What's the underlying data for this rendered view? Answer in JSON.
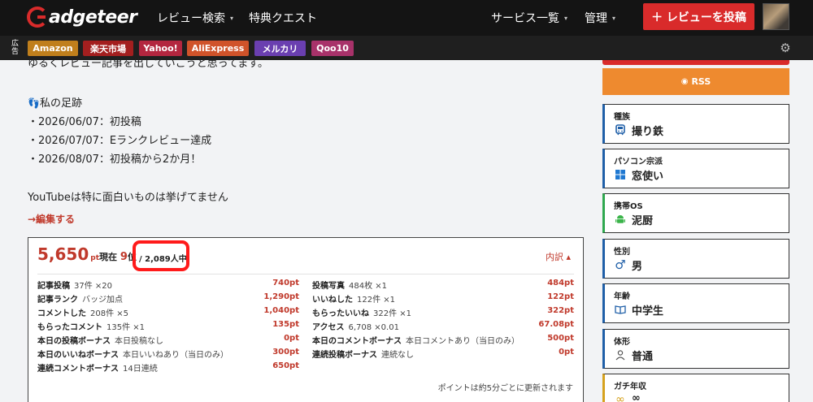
{
  "header": {
    "logo_text": "adgeteer",
    "nav_review_search": "レビュー検索",
    "nav_perk_quest": "特典クエスト",
    "nav_services": "サービス一覧",
    "nav_admin": "管理",
    "caret": "▾",
    "post_button": "＋ レビューを投稿"
  },
  "adbar": {
    "label": "広告",
    "links": [
      {
        "label": "Amazon",
        "color": "#c07f1c"
      },
      {
        "label": "楽天市場",
        "color": "#a31f1f"
      },
      {
        "label": "Yahoo!",
        "color": "#b3263f"
      },
      {
        "label": "AliExpress",
        "color": "#d0532a"
      },
      {
        "label": "メルカリ",
        "color": "#6a3fb0"
      },
      {
        "label": "Qoo10",
        "color": "#a8326a"
      }
    ]
  },
  "profile_text": {
    "intro_line": "ゆるくレビュー記事を出していこうと思ってます。",
    "footprints_heading": "私の足跡",
    "history": [
      "・2026/06/07：初投稿",
      "・2026/07/07：Eランクレビュー達成",
      "・2026/08/07：初投稿から2か月！"
    ],
    "youtube_line": "YouTubeは特に面白いものは挙げてません",
    "edit_link": "→編集する"
  },
  "points": {
    "total": "5,650",
    "unit": "pt",
    "rank_prefix": "現在",
    "rank_value": "9",
    "rank_suffix": "位",
    "rank_total": "/ 2,089人中",
    "breakdown_toggle": "内訳 ▴",
    "left_rows": [
      {
        "label": "記事投稿",
        "detail": "37件 ×20",
        "value": "740pt"
      },
      {
        "label": "記事ランク",
        "detail": "バッジ加点",
        "value": "1,290pt"
      },
      {
        "label": "コメントした",
        "detail": "208件 ×5",
        "value": "1,040pt"
      },
      {
        "label": "もらったコメント",
        "detail": "135件 ×1",
        "value": "135pt"
      },
      {
        "label": "本日の投稿ボーナス",
        "detail": "本日投稿なし",
        "value": "0pt"
      },
      {
        "label": "本日のいいねボーナス",
        "detail": "本日いいねあり（当日のみ）",
        "value": "300pt"
      },
      {
        "label": "連続コメントボーナス",
        "detail": "14日連続",
        "value": "650pt"
      }
    ],
    "right_rows": [
      {
        "label": "投稿写真",
        "detail": "484枚 ×1",
        "value": "484pt"
      },
      {
        "label": "いいねした",
        "detail": "122件 ×1",
        "value": "122pt"
      },
      {
        "label": "もらったいいね",
        "detail": "322件 ×1",
        "value": "322pt"
      },
      {
        "label": "アクセス",
        "detail": "6,708 ×0.01",
        "value": "67.08pt"
      },
      {
        "label": "本日のコメントボーナス",
        "detail": "本日コメントあり（当日のみ）",
        "value": "500pt"
      },
      {
        "label": "連続投稿ボーナス",
        "detail": "連続なし",
        "value": "0pt"
      }
    ],
    "update_note": "ポイントは約5分ごとに更新されます"
  },
  "sidebar": {
    "rss_label": "RSS",
    "cards": [
      {
        "title": "種族",
        "value": "撮り鉄",
        "icon": "train-icon",
        "accent": "#1f5fa8"
      },
      {
        "title": "パソコン宗派",
        "value": "窓使い",
        "icon": "windows-icon",
        "accent": "#1f5fa8"
      },
      {
        "title": "携帯OS",
        "value": "泥厨",
        "icon": "android-icon",
        "accent": "#2fa84f"
      },
      {
        "title": "性別",
        "value": "男",
        "icon": "male-icon",
        "accent": "#1f5fa8"
      },
      {
        "title": "年齢",
        "value": "中学生",
        "icon": "book-icon",
        "accent": "#1f5fa8"
      },
      {
        "title": "体形",
        "value": "普通",
        "icon": "person-icon",
        "accent": "#1f5fa8"
      },
      {
        "title": "ガチ年収",
        "value": "∞",
        "icon": "infinity-icon",
        "accent": "#d6a21e"
      }
    ]
  },
  "colors": {
    "brand_red": "#d92b2b",
    "point_red": "#c0392b",
    "rss_orange": "#ee8a2f",
    "highlight": "#ff1a1a"
  }
}
